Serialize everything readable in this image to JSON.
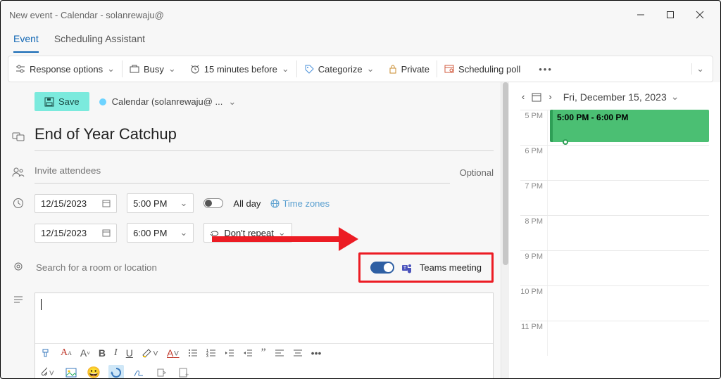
{
  "titlebar": {
    "title": "New event - Calendar - solanrewaju@"
  },
  "tabs": {
    "event": "Event",
    "scheduling": "Scheduling Assistant"
  },
  "toolbar": {
    "response": "Response options",
    "busy": "Busy",
    "reminder": "15 minutes before",
    "categorize": "Categorize",
    "private": "Private",
    "poll": "Scheduling poll"
  },
  "actions": {
    "save": "Save",
    "calendar_label": "Calendar (solanrewaju@  ...",
    "optional": "Optional",
    "allday": "All day",
    "timezones": "Time zones",
    "repeat": "Don't repeat",
    "teams": "Teams meeting"
  },
  "event": {
    "title": "End of Year Catchup",
    "invite_placeholder": "Invite attendees",
    "start_date": "12/15/2023",
    "start_time": "5:00 PM",
    "end_date": "12/15/2023",
    "end_time": "6:00 PM",
    "location_placeholder": "Search for a room or location"
  },
  "daypane": {
    "date": "Fri, December 15, 2023",
    "event_time": "5:00 PM - 6:00 PM",
    "hours": [
      "5 PM",
      "6 PM",
      "7 PM",
      "8 PM",
      "9 PM",
      "10 PM",
      "11 PM"
    ]
  }
}
